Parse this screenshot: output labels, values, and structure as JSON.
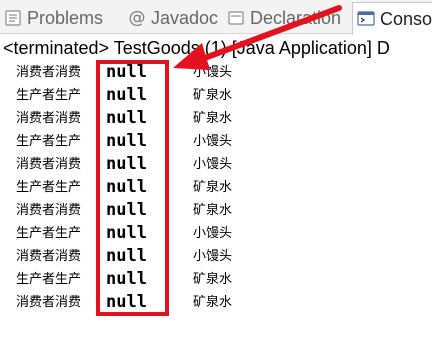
{
  "tabs": [
    {
      "label": "Problems",
      "icon": "problems-icon"
    },
    {
      "label": "Javadoc",
      "icon": "javadoc-icon"
    },
    {
      "label": "Declaration",
      "icon": "declaration-icon"
    },
    {
      "label": "Consol",
      "icon": "console-icon",
      "active": true
    }
  ],
  "console": {
    "header": "<terminated> TestGoods (1) [Java Application] D",
    "rows": [
      {
        "role": "消费者消费",
        "value": "null",
        "item": "小馒头"
      },
      {
        "role": "生产者生产",
        "value": "null",
        "item": "矿泉水"
      },
      {
        "role": "消费者消费",
        "value": "null",
        "item": "矿泉水"
      },
      {
        "role": "生产者生产",
        "value": "null",
        "item": "小馒头"
      },
      {
        "role": "消费者消费",
        "value": "null",
        "item": "小馒头"
      },
      {
        "role": "生产者生产",
        "value": "null",
        "item": "矿泉水"
      },
      {
        "role": "消费者消费",
        "value": "null",
        "item": "矿泉水"
      },
      {
        "role": "生产者生产",
        "value": "null",
        "item": "小馒头"
      },
      {
        "role": "消费者消费",
        "value": "null",
        "item": "小馒头"
      },
      {
        "role": "生产者生产",
        "value": "null",
        "item": "矿泉水"
      },
      {
        "role": "消费者消费",
        "value": "null",
        "item": "矿泉水"
      }
    ]
  },
  "annotation": {
    "color": "#e3121e"
  }
}
